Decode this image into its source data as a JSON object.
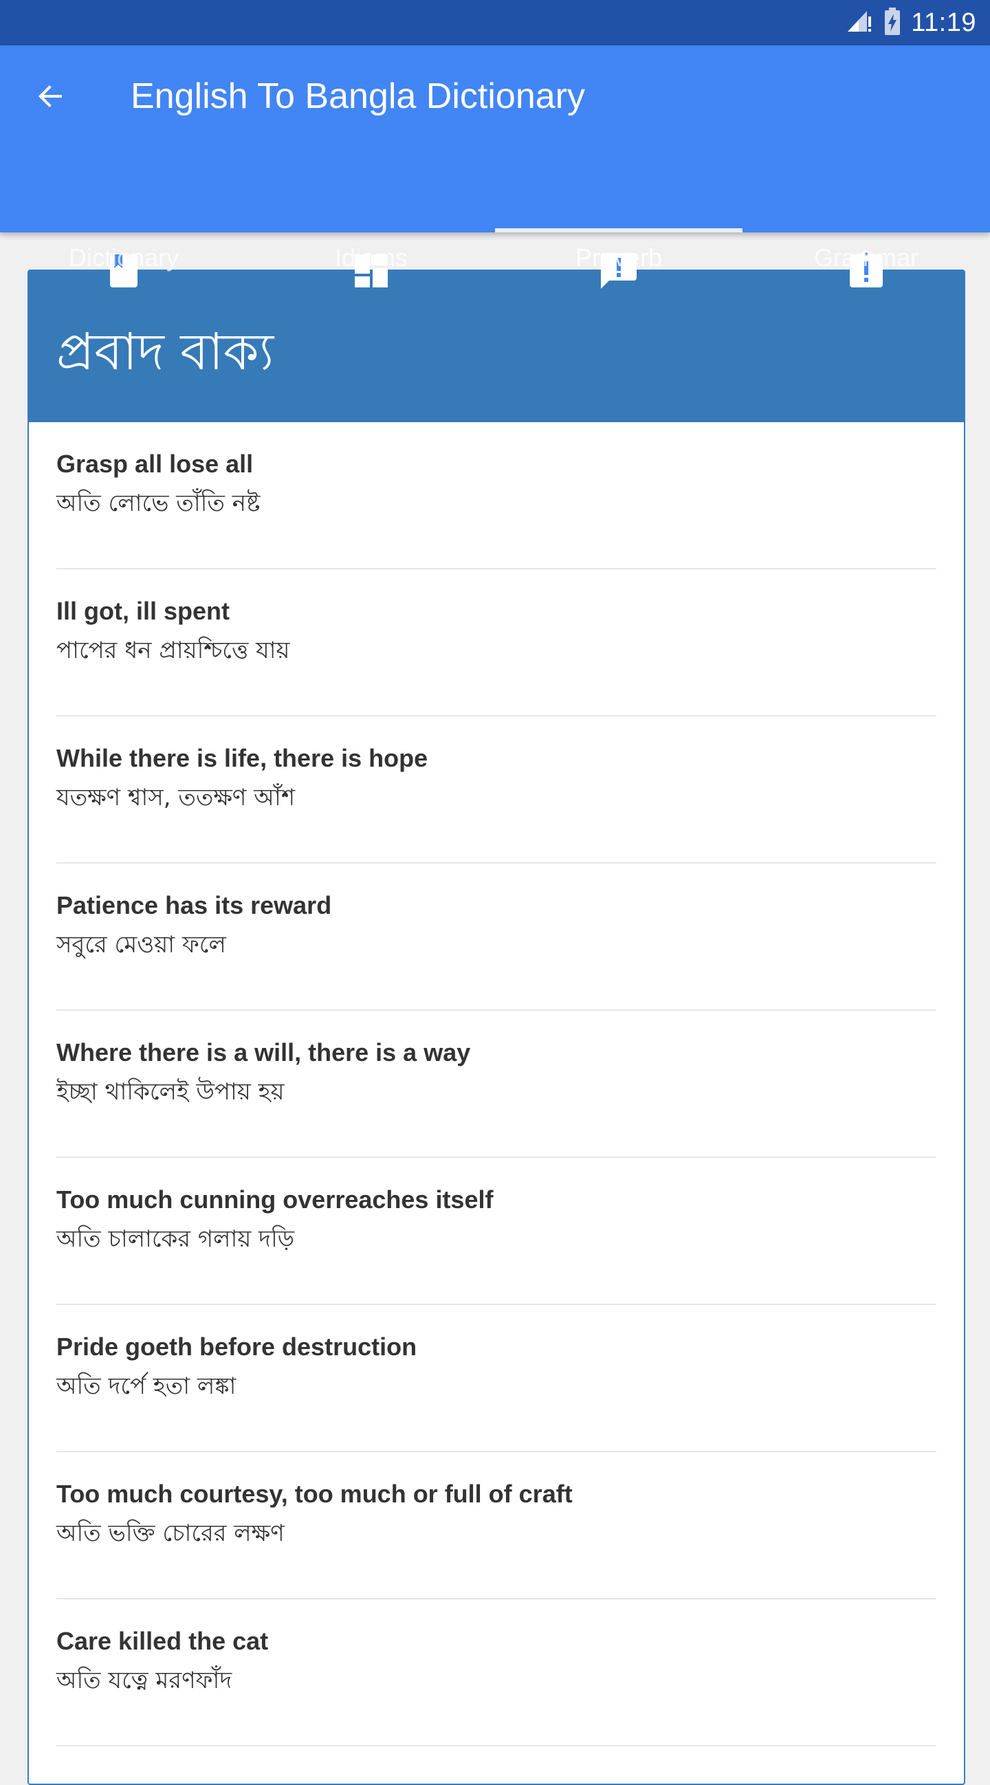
{
  "status_bar": {
    "time": "11:19",
    "signal_icon": "signal-icon",
    "battery_icon": "battery-charging-icon"
  },
  "app_bar": {
    "title": "English To Bangla Dictionary",
    "back_icon": "arrow-back-icon"
  },
  "tabs": [
    {
      "label": "Dictionary",
      "icon": "book-icon",
      "active": false
    },
    {
      "label": "Idioms",
      "icon": "dashboard-icon",
      "active": false
    },
    {
      "label": "Proverb",
      "icon": "feedback-icon",
      "active": true
    },
    {
      "label": "Grammar",
      "icon": "clipboard-alert-icon",
      "active": false
    }
  ],
  "card": {
    "title": "প্রবাদ বাক্য",
    "items": [
      {
        "english": "Grasp all lose all",
        "bangla": "অতি লোভে তাঁতি নষ্ট"
      },
      {
        "english": "Ill got, ill spent",
        "bangla": "পাপের ধন প্রায়শ্চিত্তে যায়"
      },
      {
        "english": "While there is life, there is hope",
        "bangla": "যতক্ষণ শ্বাস, ততক্ষণ আঁশ"
      },
      {
        "english": "Patience has its reward",
        "bangla": "সবুরে মেওয়া ফলে"
      },
      {
        "english": "Where there is a will, there is a way",
        "bangla": "ইচ্ছা থাকিলেই উপায় হয়"
      },
      {
        "english": "Too much cunning overreaches itself",
        "bangla": "অতি চালাকের গলায় দড়ি"
      },
      {
        "english": "Pride goeth before destruction",
        "bangla": "অতি দর্পে হতা লঙ্কা"
      },
      {
        "english": "Too much courtesy, too much or full of craft",
        "bangla": "অতি ভক্তি চোরের লক্ষণ"
      },
      {
        "english": "Care killed the cat",
        "bangla": "অতি যত্নে মরণফাঁদ"
      }
    ]
  },
  "colors": {
    "status_bar": "#2152a8",
    "app_bar": "#4285f4",
    "card_header": "#377ab8",
    "card_border": "#3a7bbf",
    "background": "#f0f0f0"
  }
}
